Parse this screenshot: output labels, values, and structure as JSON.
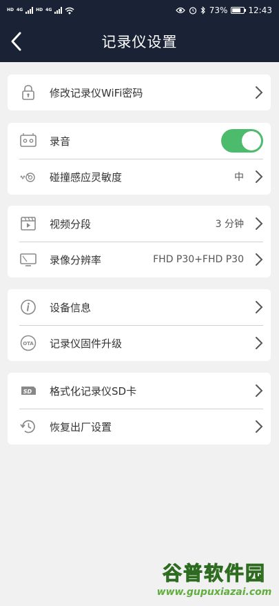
{
  "status_bar": {
    "hd1": "HD",
    "net1": "4G",
    "hd2": "HD",
    "net2": "4G",
    "battery_percent": "73%",
    "battery_level": 0.73,
    "time": "12:43"
  },
  "nav": {
    "title": "记录仪设置"
  },
  "groups": {
    "wifi": {
      "label": "修改记录仪WiFi密码"
    },
    "audio": {
      "label": "录音",
      "enabled": true
    },
    "sensitivity": {
      "label": "碰撞感应灵敏度",
      "value": "中"
    },
    "segment": {
      "label": "视频分段",
      "value": "3 分钟"
    },
    "resolution": {
      "label": "录像分辨率",
      "value": "FHD P30+FHD P30"
    },
    "device_info": {
      "label": "设备信息"
    },
    "firmware": {
      "label": "记录仪固件升级",
      "icon_text": "OTA"
    },
    "format_sd": {
      "label": "格式化记录仪SD卡",
      "icon_text": "SD"
    },
    "factory_reset": {
      "label": "恢复出厂设置"
    }
  },
  "watermark": {
    "main": "谷普软件园",
    "sub": "www.gupuxiazai.com"
  },
  "colors": {
    "header_bg": "#1a2236",
    "page_bg": "#f1f1f1",
    "toggle_on": "#4cbb6c"
  }
}
